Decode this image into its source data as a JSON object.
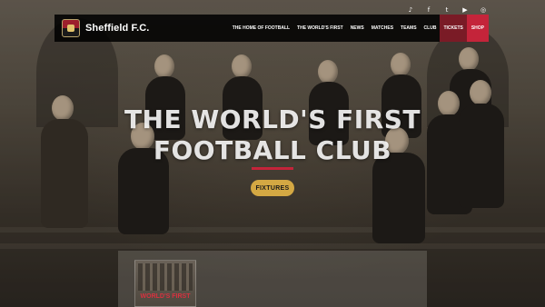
{
  "brand": {
    "name": "Sheffield F.C."
  },
  "socials": [
    {
      "icon": "tiktok-icon",
      "glyph": "♪"
    },
    {
      "icon": "facebook-icon",
      "glyph": "f"
    },
    {
      "icon": "twitter-icon",
      "glyph": "t"
    },
    {
      "icon": "youtube-icon",
      "glyph": "▶"
    },
    {
      "icon": "instagram-icon",
      "glyph": "◎"
    }
  ],
  "nav": {
    "items": [
      "THE HOME OF FOOTBALL",
      "THE WORLD'S FIRST",
      "NEWS",
      "MATCHES",
      "TEAMS",
      "CLUB",
      "TICKETS",
      "SHOP"
    ]
  },
  "hero": {
    "title_line1": "THE WORLD'S FIRST",
    "title_line2": "FOOTBALL CLUB",
    "cta": "FIXTURES"
  },
  "preview": {
    "caption": "WORLD'S FIRST"
  },
  "colors": {
    "accent_red": "#c4243a",
    "tickets_red": "#7a1b26",
    "cta_gold": "#d4a843",
    "navbar_bg": "#000000"
  }
}
